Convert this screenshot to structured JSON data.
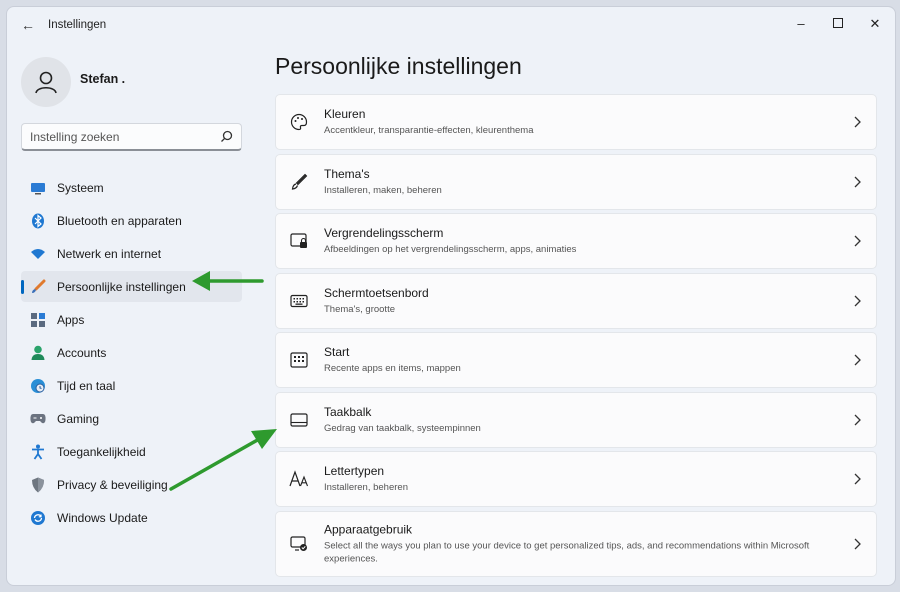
{
  "window": {
    "title": "Instellingen",
    "back_icon": "back-arrow-icon",
    "controls": [
      "minimize-icon",
      "maximize-icon",
      "close-icon"
    ]
  },
  "user": {
    "name": "Stefan ."
  },
  "search": {
    "placeholder": "Instelling zoeken"
  },
  "sidebar": {
    "items": [
      {
        "label": "Systeem",
        "icon": "monitor-icon",
        "active": false
      },
      {
        "label": "Bluetooth en apparaten",
        "icon": "bluetooth-icon",
        "active": false
      },
      {
        "label": "Netwerk en internet",
        "icon": "wifi-icon",
        "active": false
      },
      {
        "label": "Persoonlijke instellingen",
        "icon": "paintbrush-icon",
        "active": true
      },
      {
        "label": "Apps",
        "icon": "apps-icon",
        "active": false
      },
      {
        "label": "Accounts",
        "icon": "person-icon",
        "active": false
      },
      {
        "label": "Tijd en taal",
        "icon": "globe-clock-icon",
        "active": false
      },
      {
        "label": "Gaming",
        "icon": "gamepad-icon",
        "active": false
      },
      {
        "label": "Toegankelijkheid",
        "icon": "accessibility-icon",
        "active": false
      },
      {
        "label": "Privacy & beveiliging",
        "icon": "shield-icon",
        "active": false
      },
      {
        "label": "Windows Update",
        "icon": "update-icon",
        "active": false
      }
    ]
  },
  "main": {
    "title": "Persoonlijke instellingen",
    "cards": [
      {
        "title": "Kleuren",
        "subtitle": "Accentkleur, transparantie-effecten, kleurenthema",
        "icon": "palette-icon"
      },
      {
        "title": "Thema's",
        "subtitle": "Installeren, maken, beheren",
        "icon": "brush-icon"
      },
      {
        "title": "Vergrendelingsscherm",
        "subtitle": "Afbeeldingen op het vergrendelingsscherm, apps, animaties",
        "icon": "lockscreen-icon"
      },
      {
        "title": "Schermtoetsenbord",
        "subtitle": "Thema's, grootte",
        "icon": "keyboard-icon"
      },
      {
        "title": "Start",
        "subtitle": "Recente apps en items, mappen",
        "icon": "start-icon"
      },
      {
        "title": "Taakbalk",
        "subtitle": "Gedrag van taakbalk, systeempinnen",
        "icon": "taskbar-icon"
      },
      {
        "title": "Lettertypen",
        "subtitle": "Installeren, beheren",
        "icon": "fonts-icon"
      },
      {
        "title": "Apparaatgebruik",
        "subtitle": "Select all the ways you plan to use your device to get personalized tips, ads, and recommendations within Microsoft experiences.",
        "icon": "device-usage-icon"
      }
    ]
  },
  "annotations": {
    "arrow_color": "#2e9a2e"
  },
  "colors": {
    "accent": "#0067c0"
  }
}
